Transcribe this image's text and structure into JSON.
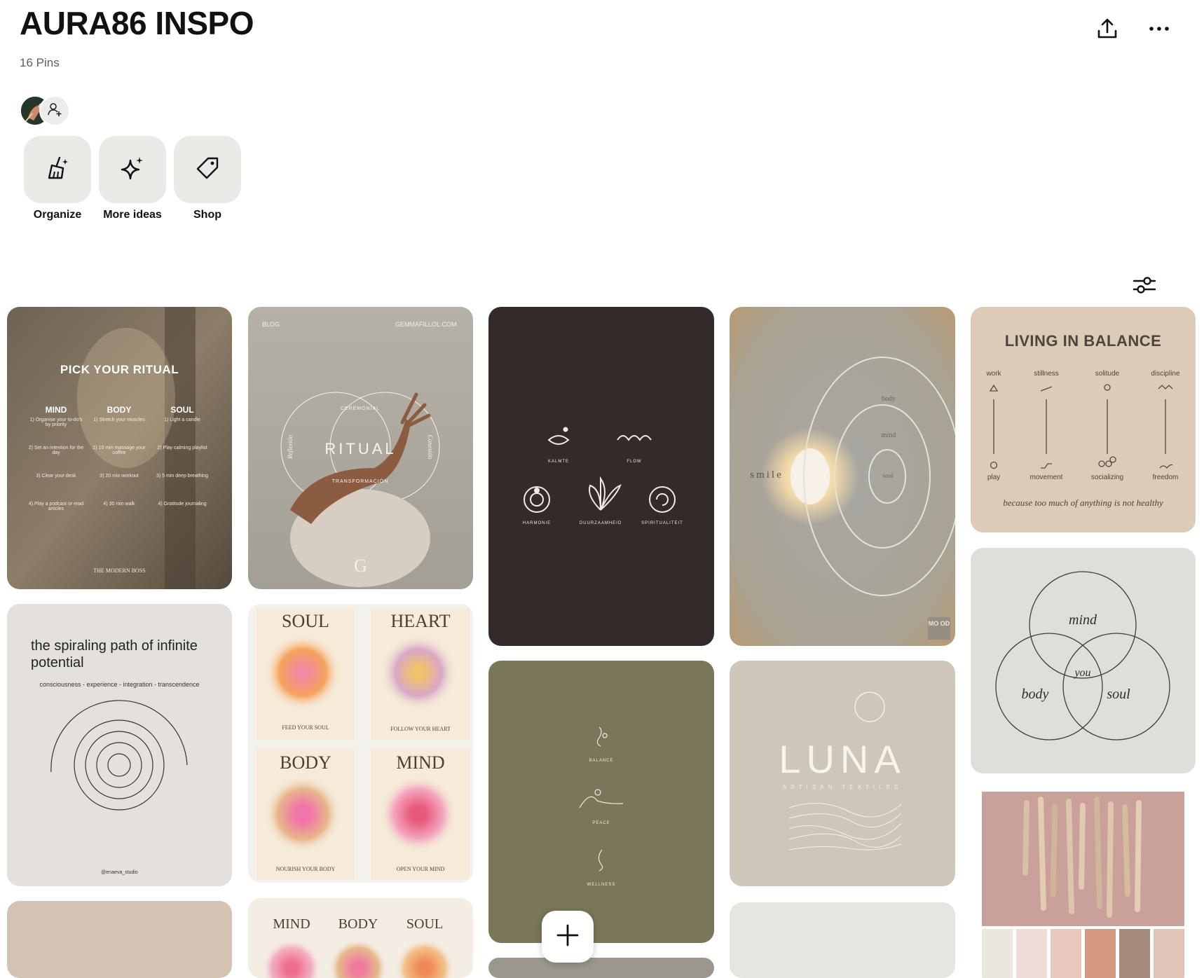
{
  "board": {
    "title": "AURA86 INSPO",
    "pin_count": "16 Pins"
  },
  "icons": {
    "share": "share-icon",
    "more": "more-icon",
    "filter": "filter-icon",
    "add_collaborator": "add-person-icon",
    "create": "plus-icon"
  },
  "actions": [
    {
      "label": "Organize",
      "icon": "broom-icon"
    },
    {
      "label": "More ideas",
      "icon": "sparkle-icon"
    },
    {
      "label": "Shop",
      "icon": "tag-icon"
    }
  ],
  "pins": {
    "ritual_pick": {
      "title": "PICK YOUR RITUAL",
      "columns": [
        {
          "head": "MIND",
          "items": [
            "1) Organise your to-do's by priority",
            "2) Set an intention for the day",
            "3) Clear your desk",
            "4) Play a podcast or read articles"
          ]
        },
        {
          "head": "BODY",
          "items": [
            "1) Stretch your muscles",
            "2) 10 min massage your coffee",
            "3) 20 min workout",
            "4) 30 min walk"
          ]
        },
        {
          "head": "SOUL",
          "items": [
            "1) Light a candle",
            "2) Play calming playlist",
            "3) 5 min deep breathing",
            "4) Gratitude journaling"
          ]
        }
      ],
      "footer": "THE MODERN BOSS"
    },
    "ritual_circles": {
      "blog": "BLOG",
      "site": "GEMMAFILLOL.COM",
      "word": "RITUAL",
      "left_word": "Reflexión",
      "right_word": "Conexión",
      "top_word": "CEREMONIAL",
      "bottom_word": "TRANSFORMACIÓN",
      "logo": "G"
    },
    "symbols": {
      "labels": [
        "KALMTE",
        "FLOW",
        "HARMONIE",
        "DUURZAAMHEID",
        "SPIRITUALITEIT"
      ]
    },
    "smile_wall": {
      "brand": "smile",
      "rings": [
        "body",
        "mind",
        "soul"
      ],
      "badge": "MO OD"
    },
    "balance": {
      "title": "LIVING IN BALANCE",
      "top": [
        "work",
        "stillness",
        "solitude",
        "discipline"
      ],
      "bottom": [
        "play",
        "movement",
        "socializing",
        "freedom"
      ],
      "caption": "because too much of anything is not healthy"
    },
    "spiral": {
      "quote": "the spiraling path of infinite potential",
      "sub": "consciousness - experience - integration - transcendence",
      "handle": "@enaeva_studio"
    },
    "aura_cards": [
      {
        "title": "SOUL",
        "caption": "FEED YOUR SOUL",
        "c1": "#f28aa0",
        "c2": "#f5a25a"
      },
      {
        "title": "HEART",
        "caption": "FOLLOW YOUR HEART",
        "c1": "#f0c36a",
        "c2": "#d9a7c8"
      },
      {
        "title": "BODY",
        "caption": "NOURISH YOUR BODY",
        "c1": "#f075a8",
        "c2": "#e8b58a"
      },
      {
        "title": "MIND",
        "caption": "OPEN YOUR MIND",
        "c1": "#e85a7a",
        "c2": "#f4a6c0"
      }
    ],
    "green": {
      "labels": [
        "BALANCE",
        "PEACE",
        "WELLNESS"
      ]
    },
    "luna": {
      "word": "LUNA",
      "sub": "ARTISAN TEXTILES"
    },
    "venn": {
      "labels": [
        "mind",
        "body",
        "soul",
        "you"
      ]
    },
    "three_aura": {
      "labels": [
        "MIND",
        "BODY",
        "SOUL"
      ]
    }
  },
  "colors": {
    "tile_bg": "#e9e9e6",
    "symbols_bg": "#322b29",
    "green_bg": "#7a765a",
    "luna_bg": "#cec6b8",
    "balance_bg": "#dccbb6"
  }
}
